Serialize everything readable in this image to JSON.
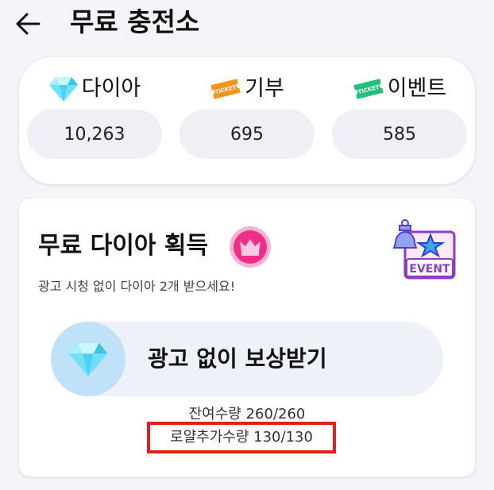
{
  "header": {
    "back_icon": "arrow-left-icon",
    "title": "무료 충전소"
  },
  "currencies": [
    {
      "label": "다이아",
      "value": "10,263",
      "icon": "diamond-icon"
    },
    {
      "label": "기부",
      "value": "695",
      "icon": "ticket-icon",
      "icon_text": "TICKET",
      "icon_color": "#f5941e"
    },
    {
      "label": "이벤트",
      "value": "585",
      "icon": "ticket-icon",
      "icon_text": "TICKET",
      "icon_color": "#22c07a"
    }
  ],
  "reward": {
    "title": "무료 다이아 획득",
    "crown_icon": "crown-badge-icon",
    "event_icon": "event-bell-icon",
    "event_text": "EVENT",
    "description": "광고 시청 없이 다이아 2개 받으세요!",
    "button_label": "광고 없이 보상받기",
    "remaining": "잔여수량 260/260",
    "royal_remaining": "로얄추가수량 130/130"
  },
  "colors": {
    "highlight_border": "#e0211d",
    "crown_pink": "#ef2f86",
    "diamond": "#5fd5f0"
  }
}
